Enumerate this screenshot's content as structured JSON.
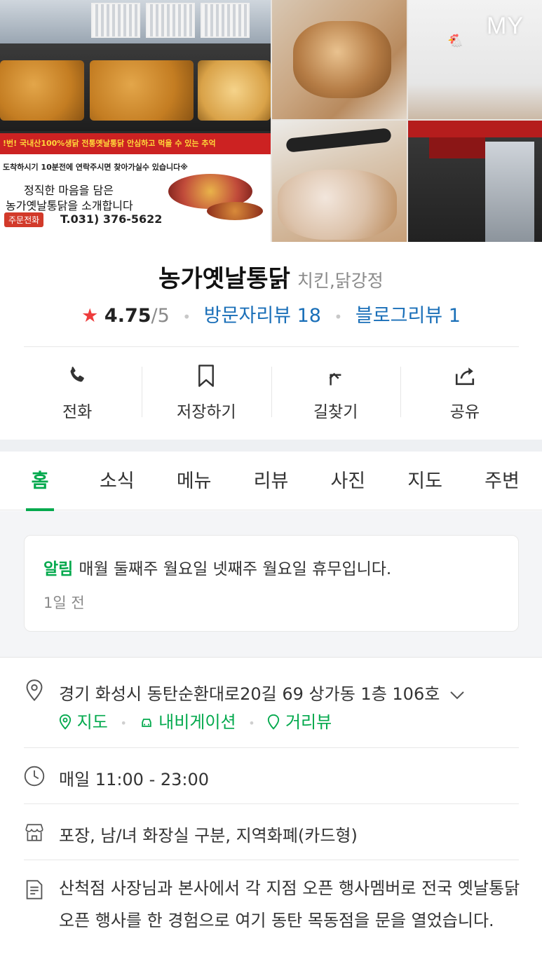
{
  "photos": {
    "main_banner": {
      "top_line": "!번! 국내산100%생닭 전통옛날통닭 안심하고 먹을 수 있는 추억",
      "line2": "도착하시기 10분전에 연락주시면 찾아가실수 있습니다※",
      "line3": "정직한 마음을 담은",
      "line4": "농가옛날통닭을 소개합니다",
      "badge": "주문전화",
      "phone": "T.031) 376-5622"
    },
    "overlay_label": "MY"
  },
  "place": {
    "name": "농가옛날통닭",
    "category": "치킨,닭강정",
    "rating": "4.75",
    "rating_max": "/5",
    "visitor_reviews": "방문자리뷰 18",
    "blog_reviews": "블로그리뷰 1"
  },
  "actions": [
    {
      "label": "전화",
      "icon": "phone-icon"
    },
    {
      "label": "저장하기",
      "icon": "bookmark-icon"
    },
    {
      "label": "길찾기",
      "icon": "directions-icon"
    },
    {
      "label": "공유",
      "icon": "share-icon"
    }
  ],
  "tabs": [
    "홈",
    "소식",
    "메뉴",
    "리뷰",
    "사진",
    "지도",
    "주변"
  ],
  "active_tab": "홈",
  "notice": {
    "tag": "알림",
    "text": "매월 둘째주 월요일 넷째주 월요일 휴무입니다.",
    "time": "1일 전"
  },
  "info": {
    "address": "경기 화성시 동탄순환대로20길 69 상가동 1층 106호",
    "address_links": [
      "지도",
      "내비게이션",
      "거리뷰"
    ],
    "hours": "매일 11:00 - 23:00",
    "facilities": "포장, 남/녀 화장실 구분, 지역화폐(카드형)",
    "description": "산척점 사장님과 본사에서 각 지점 오픈 행사멤버로 전국 옛날통닭 오픈 행사를 한 경험으로 여기 동탄 목동점을 문을 열었습니다."
  },
  "colors": {
    "green": "#03a94d",
    "blue_link": "#1a6fb8",
    "star_red": "#ee3d3d"
  }
}
